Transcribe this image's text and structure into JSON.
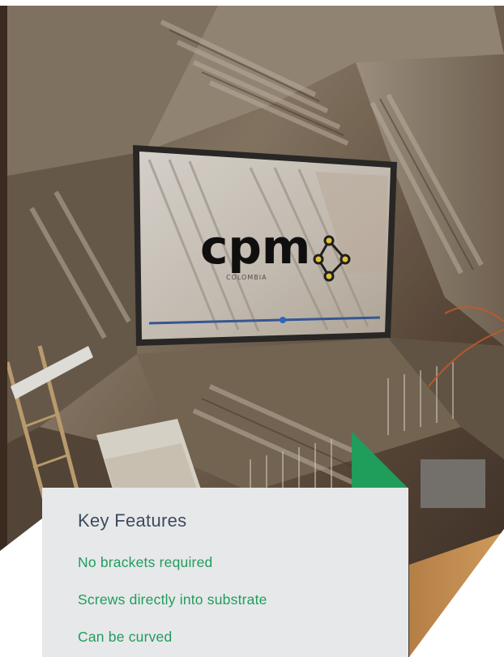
{
  "photo": {
    "icon": "construction-stairwell-photo",
    "screen_logo_text": "cpm",
    "screen_logo_subtext": "COLOMBIA"
  },
  "features": {
    "title": "Key Features",
    "items": [
      "No brackets required",
      "Screws directly into substrate",
      "Can be curved"
    ]
  },
  "colors": {
    "accent_green": "#1f9d5b",
    "card_bg": "#e7e8ea",
    "title_text": "#3c4b5b"
  }
}
